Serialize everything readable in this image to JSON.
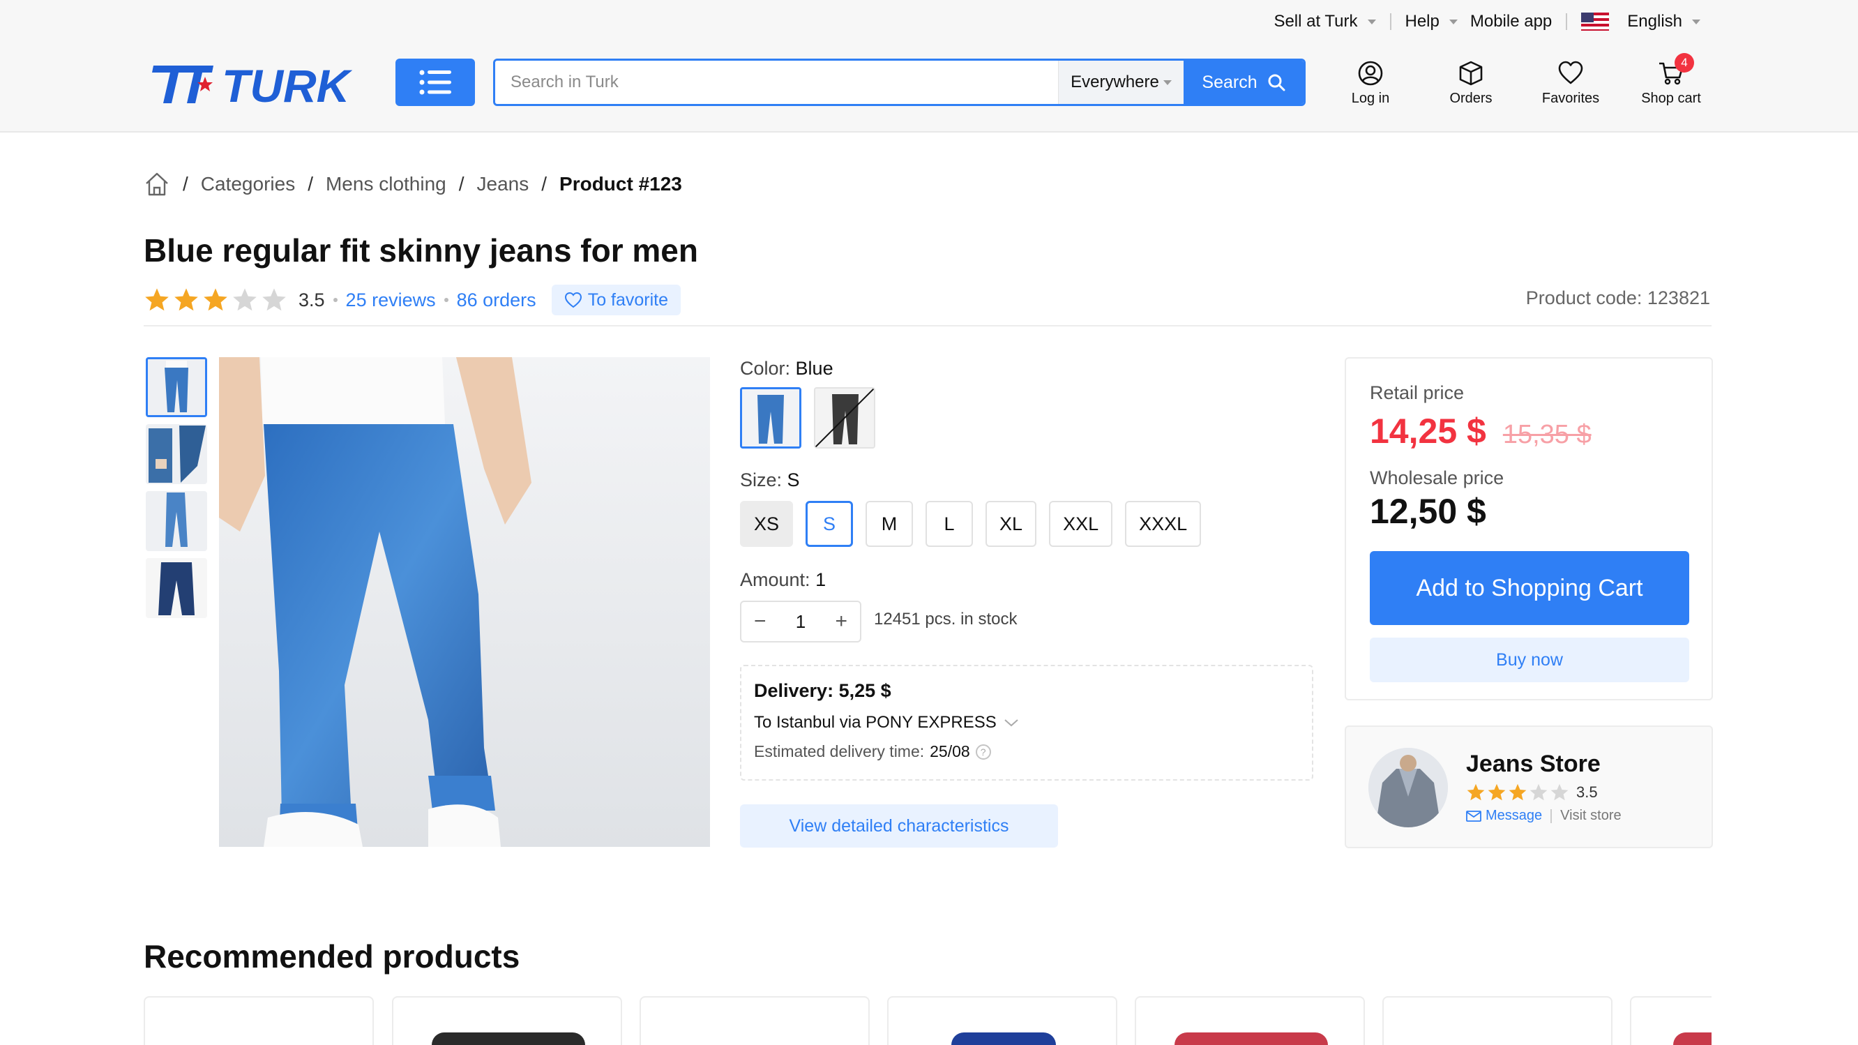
{
  "header": {
    "top_links": {
      "sell": "Sell at Turk",
      "help": "Help",
      "mobile_app": "Mobile app",
      "language": "English"
    },
    "brand": "TURK",
    "search": {
      "placeholder": "Search in Turk",
      "scope": "Everywhere",
      "button_label": "Search"
    },
    "icons": {
      "login": "Log in",
      "orders": "Orders",
      "favorites": "Favorites",
      "cart": "Shop cart",
      "cart_count": "4"
    }
  },
  "breadcrumb": {
    "items": [
      "Categories",
      "Mens clothing",
      "Jeans"
    ],
    "current": "Product #123"
  },
  "product": {
    "title": "Blue regular fit skinny jeans for men",
    "rating": "3.5",
    "rating_value": 3.5,
    "reviews": "25 reviews",
    "orders": "86 orders",
    "favorite_label": "To favorite",
    "code": "Product code: 123821",
    "color_label": "Color:",
    "color_value": "Blue",
    "size_label": "Size:",
    "size_value": "S",
    "sizes": [
      "XS",
      "S",
      "M",
      "L",
      "XL",
      "XXL",
      "XXXL"
    ],
    "amount_label": "Amount:",
    "amount_value": "1",
    "quantity": "1",
    "stock": "12451 pcs. in stock",
    "delivery": {
      "title": "Delivery: 5,25 $",
      "route": "To Istanbul via PONY EXPRESS",
      "eta_label": "Estimated delivery time:",
      "eta_value": "25/08"
    },
    "details_button": "View detailed characteristics"
  },
  "pricing": {
    "retail_label": "Retail price",
    "retail_price": "14,25 $",
    "old_price": "15,35 $",
    "wholesale_label": "Wholesale price",
    "wholesale_price": "12,50 $",
    "add_to_cart": "Add to Shopping Cart",
    "buy_now": "Buy now"
  },
  "store": {
    "name": "Jeans Store",
    "rating": "3.5",
    "rating_value": 3.5,
    "message": "Message",
    "visit": "Visit store"
  },
  "recommended": {
    "title": "Recommended products"
  },
  "colors": {
    "accent": "#2f7ff5",
    "price": "#f23340",
    "star": "#f5a623",
    "star_empty": "#d6d6d6"
  }
}
